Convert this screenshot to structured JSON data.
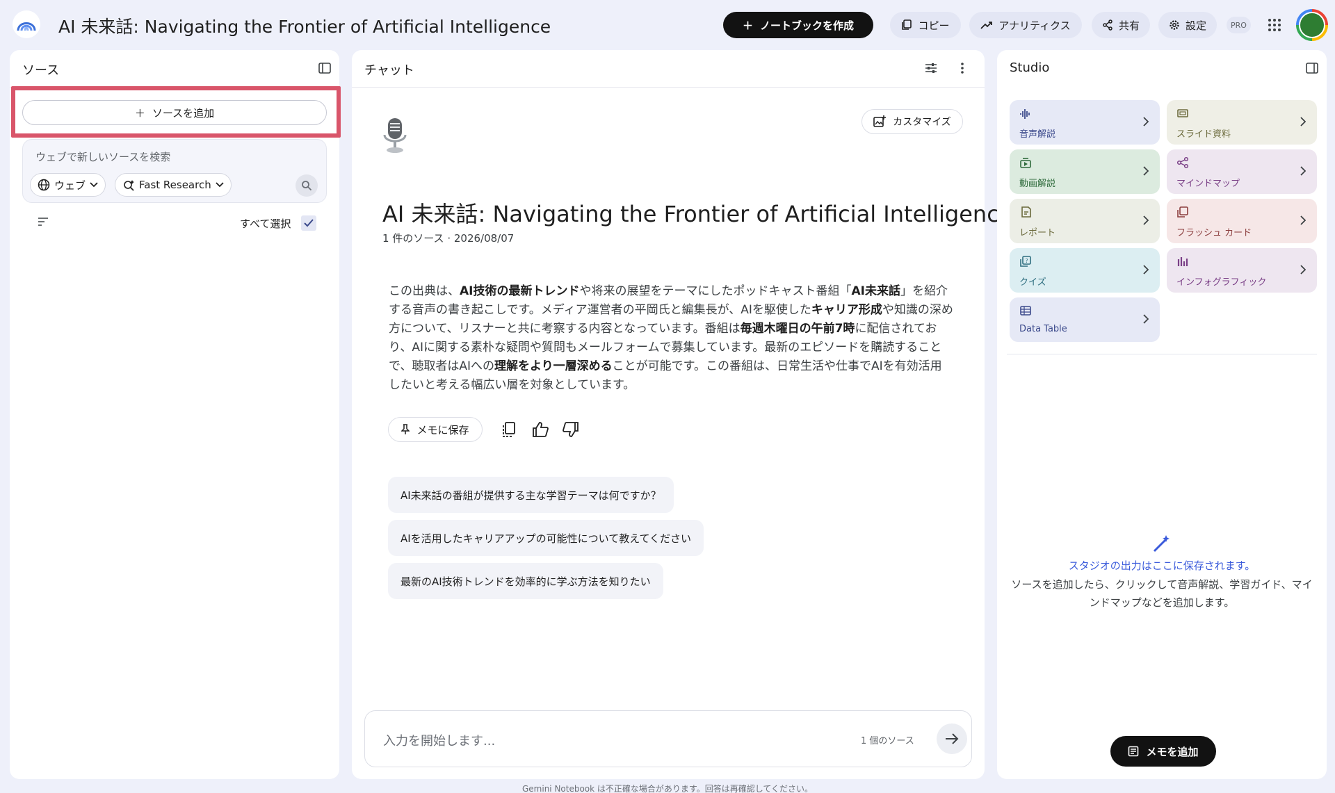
{
  "header": {
    "title": "AI 未来話: Navigating the Frontier of Artificial Intelligence",
    "create_notebook": "ノートブックを作成",
    "copy": "コピー",
    "analytics": "アナリティクス",
    "share": "共有",
    "settings": "設定",
    "pro_badge": "PRO"
  },
  "sources": {
    "title": "ソース",
    "add_source": "ソースを追加",
    "search_placeholder": "ウェブで新しいソースを検索",
    "web_chip": "ウェブ",
    "research_chip": "Fast Research",
    "select_all": "すべて選択",
    "select_all_checked": true,
    "highlight_color": "#d9556a"
  },
  "chat": {
    "title": "チャット",
    "customize": "カスタマイズ",
    "notebook_title": "AI 未来話: Navigating the Frontier of Artificial Intelligence",
    "meta": "1 件のソース · 2026/08/07",
    "summary": [
      {
        "t": "この出典は、"
      },
      {
        "t": "AI技術の最新トレンド",
        "b": true
      },
      {
        "t": "や将来の展望をテーマにしたポッドキャスト番組「"
      },
      {
        "t": "AI未来話",
        "b": true
      },
      {
        "t": "」を紹介する音声の書き起こしです。メディア運営者の平岡氏と編集長が、AIを駆使した"
      },
      {
        "t": "キャリア形成",
        "b": true
      },
      {
        "t": "や知識の深め方について、リスナーと共に考察する内容となっています。番組は"
      },
      {
        "t": "毎週木曜日の午前7時",
        "b": true
      },
      {
        "t": "に配信されており、AIに関する素朴な疑問や質問もメールフォームで募集しています。最新のエピソードを購読することで、聴取者はAIへの"
      },
      {
        "t": "理解をより一層深める",
        "b": true
      },
      {
        "t": "ことが可能です。この番組は、日常生活や仕事でAIを有効活用したいと考える幅広い層を対象としています。"
      }
    ],
    "save_to_memo": "メモに保存",
    "suggestions": [
      "AI未来話の番組が提供する主な学習テーマは何ですか？",
      "AIを活用したキャリアアップの可能性について教えてください",
      "最新のAI技術トレンドを効率的に学ぶ方法を知りたい"
    ],
    "input_placeholder": "入力を開始します...",
    "source_count": "1 個のソース"
  },
  "studio": {
    "title": "Studio",
    "tiles": [
      {
        "label": "音声解説",
        "icon": "audio-waveform-icon",
        "bg": "#e6e9f6",
        "fg": "#3c4a8c"
      },
      {
        "label": "スライド資料",
        "icon": "slides-icon",
        "bg": "#efefe6",
        "fg": "#6b6a3c"
      },
      {
        "label": "動画解説",
        "icon": "video-icon",
        "bg": "#dcebdf",
        "fg": "#2f6b3c"
      },
      {
        "label": "マインドマップ",
        "icon": "mind-map-icon",
        "bg": "#eee6f0",
        "fg": "#7a3f86"
      },
      {
        "label": "レポート",
        "icon": "report-icon",
        "bg": "#eceee6",
        "fg": "#6b6a3c"
      },
      {
        "label": "フラッシュ カード",
        "icon": "flashcards-icon",
        "bg": "#f6e7e7",
        "fg": "#8c3f3f"
      },
      {
        "label": "クイズ",
        "icon": "quiz-icon",
        "bg": "#dceef2",
        "fg": "#2f6f80"
      },
      {
        "label": "インフォグラフィック",
        "icon": "infographic-icon",
        "bg": "#eee6f0",
        "fg": "#7a3f86"
      },
      {
        "label": "Data Table",
        "icon": "data-table-icon",
        "bg": "#e6e9f6",
        "fg": "#3c4a8c"
      }
    ],
    "empty_title": "スタジオの出力はここに保存されます。",
    "empty_desc": "ソースを追加したら、クリックして音声解説、学習ガイド、マインドマップなどを追加します。",
    "add_memo": "メモを追加"
  },
  "footer": {
    "disclaimer": "Gemini Notebook は不正確な場合があります。回答は再確認してください。"
  }
}
